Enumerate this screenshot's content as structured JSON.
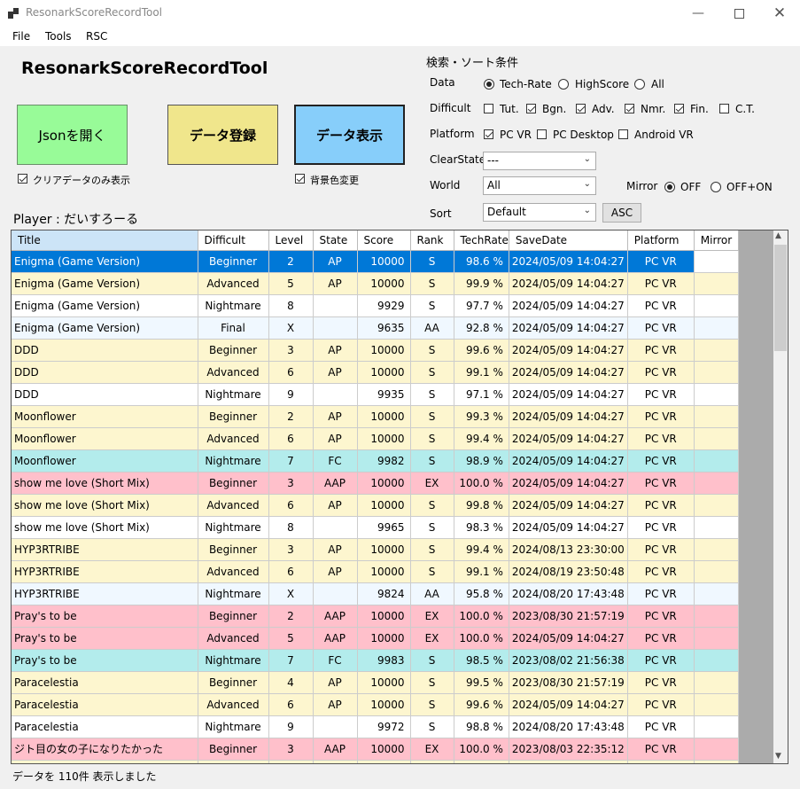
{
  "window": {
    "title": "ResonarkScoreRecordTool"
  },
  "menu": [
    "File",
    "Tools",
    "RSC"
  ],
  "heading": "ResonarkScoreRecordTool",
  "buttons": {
    "open_json": "Jsonを開く",
    "register": "データ登録",
    "display": "データ表示"
  },
  "options": {
    "clear_only": "クリアデータのみ表示",
    "bg_color": "背景色変更"
  },
  "player_label": "Player : だいすろーる",
  "search": {
    "section_title": "検索・ソート条件",
    "data_label": "Data",
    "data_options": [
      "Tech-Rate",
      "HighScore",
      "All"
    ],
    "data_selected": "Tech-Rate",
    "difficult_label": "Difficult",
    "difficult_options": [
      {
        "label": "Tut.",
        "checked": false
      },
      {
        "label": "Bgn.",
        "checked": true
      },
      {
        "label": "Adv.",
        "checked": true
      },
      {
        "label": "Nmr.",
        "checked": true
      },
      {
        "label": "Fin.",
        "checked": true
      },
      {
        "label": "C.T.",
        "checked": false
      }
    ],
    "platform_label": "Platform",
    "platform_options": [
      {
        "label": "PC VR",
        "checked": true
      },
      {
        "label": "PC Desktop",
        "checked": false
      },
      {
        "label": "Android VR",
        "checked": false
      }
    ],
    "clearstate_label": "ClearState",
    "clearstate_value": "---",
    "world_label": "World",
    "world_value": "All",
    "mirror_label": "Mirror",
    "mirror_options": [
      "OFF",
      "OFF+ON"
    ],
    "mirror_selected": "OFF",
    "sort_label": "Sort",
    "sort_value": "Default",
    "order_button": "ASC"
  },
  "table": {
    "columns": [
      "Title",
      "Difficult",
      "Level",
      "State",
      "Score",
      "Rank",
      "TechRate",
      "SaveDate",
      "Platform",
      "Mirror"
    ],
    "rows": [
      {
        "title": "Enigma (Game Version)",
        "difficult": "Beginner",
        "level": "2",
        "state": "AP",
        "score": "10000",
        "rank": "S",
        "techrate": "98.6 %",
        "savedate": "2024/05/09 14:04:27",
        "platform": "PC VR",
        "mirror": "",
        "color": "#0078d7",
        "selected": true
      },
      {
        "title": "Enigma (Game Version)",
        "difficult": "Advanced",
        "level": "5",
        "state": "AP",
        "score": "10000",
        "rank": "S",
        "techrate": "99.9 %",
        "savedate": "2024/05/09 14:04:27",
        "platform": "PC VR",
        "mirror": "",
        "color": "#fdf6cf"
      },
      {
        "title": "Enigma (Game Version)",
        "difficult": "Nightmare",
        "level": "8",
        "state": "",
        "score": "9929",
        "rank": "S",
        "techrate": "97.7 %",
        "savedate": "2024/05/09 14:04:27",
        "platform": "PC VR",
        "mirror": "",
        "color": "#ffffff"
      },
      {
        "title": "Enigma (Game Version)",
        "difficult": "Final",
        "level": "X",
        "state": "",
        "score": "9635",
        "rank": "AA",
        "techrate": "92.8 %",
        "savedate": "2024/05/09 14:04:27",
        "platform": "PC VR",
        "mirror": "",
        "color": "#f0f8ff"
      },
      {
        "title": "DDD",
        "difficult": "Beginner",
        "level": "3",
        "state": "AP",
        "score": "10000",
        "rank": "S",
        "techrate": "99.6 %",
        "savedate": "2024/05/09 14:04:27",
        "platform": "PC VR",
        "mirror": "",
        "color": "#fdf6cf"
      },
      {
        "title": "DDD",
        "difficult": "Advanced",
        "level": "6",
        "state": "AP",
        "score": "10000",
        "rank": "S",
        "techrate": "99.1 %",
        "savedate": "2024/05/09 14:04:27",
        "platform": "PC VR",
        "mirror": "",
        "color": "#fdf6cf"
      },
      {
        "title": "DDD",
        "difficult": "Nightmare",
        "level": "9",
        "state": "",
        "score": "9935",
        "rank": "S",
        "techrate": "97.1 %",
        "savedate": "2024/05/09 14:04:27",
        "platform": "PC VR",
        "mirror": "",
        "color": "#ffffff"
      },
      {
        "title": "Moonflower",
        "difficult": "Beginner",
        "level": "2",
        "state": "AP",
        "score": "10000",
        "rank": "S",
        "techrate": "99.3 %",
        "savedate": "2024/05/09 14:04:27",
        "platform": "PC VR",
        "mirror": "",
        "color": "#fdf6cf"
      },
      {
        "title": "Moonflower",
        "difficult": "Advanced",
        "level": "6",
        "state": "AP",
        "score": "10000",
        "rank": "S",
        "techrate": "99.4 %",
        "savedate": "2024/05/09 14:04:27",
        "platform": "PC VR",
        "mirror": "",
        "color": "#fdf6cf"
      },
      {
        "title": "Moonflower",
        "difficult": "Nightmare",
        "level": "7",
        "state": "FC",
        "score": "9982",
        "rank": "S",
        "techrate": "98.9 %",
        "savedate": "2024/05/09 14:04:27",
        "platform": "PC VR",
        "mirror": "",
        "color": "#b3ecec"
      },
      {
        "title": "show me love (Short Mix)",
        "difficult": "Beginner",
        "level": "3",
        "state": "AAP",
        "score": "10000",
        "rank": "EX",
        "techrate": "100.0 %",
        "savedate": "2024/05/09 14:04:27",
        "platform": "PC VR",
        "mirror": "",
        "color": "#ffc0cb"
      },
      {
        "title": "show me love (Short Mix)",
        "difficult": "Advanced",
        "level": "6",
        "state": "AP",
        "score": "10000",
        "rank": "S",
        "techrate": "99.8 %",
        "savedate": "2024/05/09 14:04:27",
        "platform": "PC VR",
        "mirror": "",
        "color": "#fdf6cf"
      },
      {
        "title": "show me love (Short Mix)",
        "difficult": "Nightmare",
        "level": "8",
        "state": "",
        "score": "9965",
        "rank": "S",
        "techrate": "98.3 %",
        "savedate": "2024/05/09 14:04:27",
        "platform": "PC VR",
        "mirror": "",
        "color": "#ffffff"
      },
      {
        "title": "HYP3RTRIBE",
        "difficult": "Beginner",
        "level": "3",
        "state": "AP",
        "score": "10000",
        "rank": "S",
        "techrate": "99.4 %",
        "savedate": "2024/08/13 23:30:00",
        "platform": "PC VR",
        "mirror": "",
        "color": "#fdf6cf"
      },
      {
        "title": "HYP3RTRIBE",
        "difficult": "Advanced",
        "level": "6",
        "state": "AP",
        "score": "10000",
        "rank": "S",
        "techrate": "99.1 %",
        "savedate": "2024/08/19 23:50:48",
        "platform": "PC VR",
        "mirror": "",
        "color": "#fdf6cf"
      },
      {
        "title": "HYP3RTRIBE",
        "difficult": "Nightmare",
        "level": "X",
        "state": "",
        "score": "9824",
        "rank": "AA",
        "techrate": "95.8 %",
        "savedate": "2024/08/20 17:43:48",
        "platform": "PC VR",
        "mirror": "",
        "color": "#f0f8ff"
      },
      {
        "title": "Pray's to be",
        "difficult": "Beginner",
        "level": "2",
        "state": "AAP",
        "score": "10000",
        "rank": "EX",
        "techrate": "100.0 %",
        "savedate": "2023/08/30 21:57:19",
        "platform": "PC VR",
        "mirror": "",
        "color": "#ffc0cb"
      },
      {
        "title": "Pray's to be",
        "difficult": "Advanced",
        "level": "5",
        "state": "AAP",
        "score": "10000",
        "rank": "EX",
        "techrate": "100.0 %",
        "savedate": "2024/05/09 14:04:27",
        "platform": "PC VR",
        "mirror": "",
        "color": "#ffc0cb"
      },
      {
        "title": "Pray's to be",
        "difficult": "Nightmare",
        "level": "7",
        "state": "FC",
        "score": "9983",
        "rank": "S",
        "techrate": "98.5 %",
        "savedate": "2023/08/02 21:56:38",
        "platform": "PC VR",
        "mirror": "",
        "color": "#b3ecec"
      },
      {
        "title": "Paracelestia",
        "difficult": "Beginner",
        "level": "4",
        "state": "AP",
        "score": "10000",
        "rank": "S",
        "techrate": "99.5 %",
        "savedate": "2023/08/30 21:57:19",
        "platform": "PC VR",
        "mirror": "",
        "color": "#fdf6cf"
      },
      {
        "title": "Paracelestia",
        "difficult": "Advanced",
        "level": "6",
        "state": "AP",
        "score": "10000",
        "rank": "S",
        "techrate": "99.6 %",
        "savedate": "2024/05/09 14:04:27",
        "platform": "PC VR",
        "mirror": "",
        "color": "#fdf6cf"
      },
      {
        "title": "Paracelestia",
        "difficult": "Nightmare",
        "level": "9",
        "state": "",
        "score": "9972",
        "rank": "S",
        "techrate": "98.8 %",
        "savedate": "2024/08/20 17:43:48",
        "platform": "PC VR",
        "mirror": "",
        "color": "#ffffff"
      },
      {
        "title": "ジト目の女の子になりたかった",
        "difficult": "Beginner",
        "level": "3",
        "state": "AAP",
        "score": "10000",
        "rank": "EX",
        "techrate": "100.0 %",
        "savedate": "2023/08/03 22:35:12",
        "platform": "PC VR",
        "mirror": "",
        "color": "#ffc0cb"
      },
      {
        "title": "",
        "difficult": "",
        "level": "",
        "state": "",
        "score": "",
        "rank": "",
        "techrate": "",
        "savedate": "",
        "platform": "",
        "mirror": "",
        "color": "#fdf6cf"
      }
    ]
  },
  "status": "データを 110件 表示しました",
  "colors": {
    "open_json_bg": "#98fb98",
    "register_bg": "#f0e68c",
    "display_bg": "#87cefa",
    "selected_row": "#0078d7",
    "header_selected": "#cce4f7"
  }
}
